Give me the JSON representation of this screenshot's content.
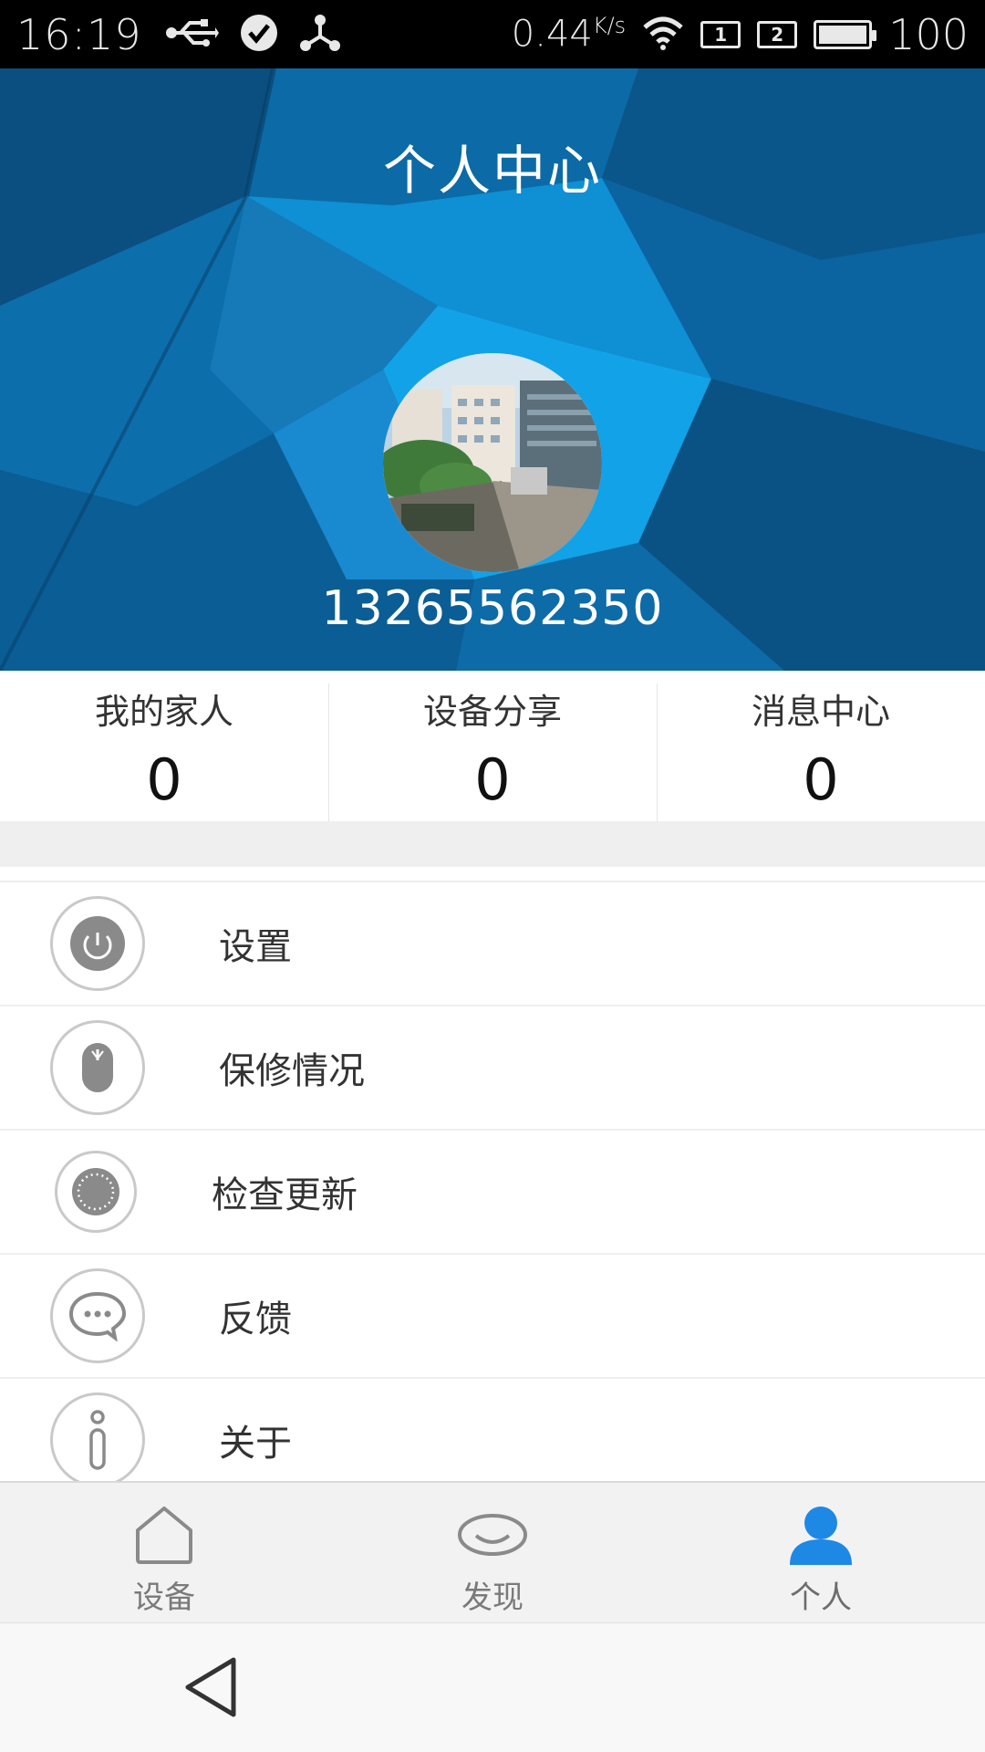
{
  "status_bar": {
    "time": "16:19",
    "speed": "0.44",
    "speed_unit": "K/s",
    "sim1": "1",
    "sim2": "2",
    "battery": "100",
    "icons": [
      "usb-icon",
      "check-circle-icon",
      "share-hub-icon",
      "wifi-icon",
      "sim-card-icon",
      "battery-icon"
    ]
  },
  "header": {
    "title": "个人中心",
    "phone": "13265562350",
    "avatar_icon": "avatar-photo"
  },
  "stats": [
    {
      "label": "我的家人",
      "value": "0"
    },
    {
      "label": "设备分享",
      "value": "0"
    },
    {
      "label": "消息中心",
      "value": "0"
    }
  ],
  "menu": [
    {
      "label": "设置",
      "icon": "power-icon"
    },
    {
      "label": "保修情况",
      "icon": "mouse-icon"
    },
    {
      "label": "检查更新",
      "icon": "dotted-circle-icon"
    },
    {
      "label": "反馈",
      "icon": "chat-bubble-icon"
    },
    {
      "label": "关于",
      "icon": "info-icon"
    }
  ],
  "bottom_nav": [
    {
      "label": "设备",
      "icon": "home-icon",
      "active": false
    },
    {
      "label": "发现",
      "icon": "eye-icon",
      "active": false
    },
    {
      "label": "个人",
      "icon": "person-icon",
      "active": true
    }
  ],
  "colors": {
    "header_blue": "#0a5a8e",
    "accent_blue": "#1e88e5",
    "icon_gray": "#8a8a8a"
  }
}
